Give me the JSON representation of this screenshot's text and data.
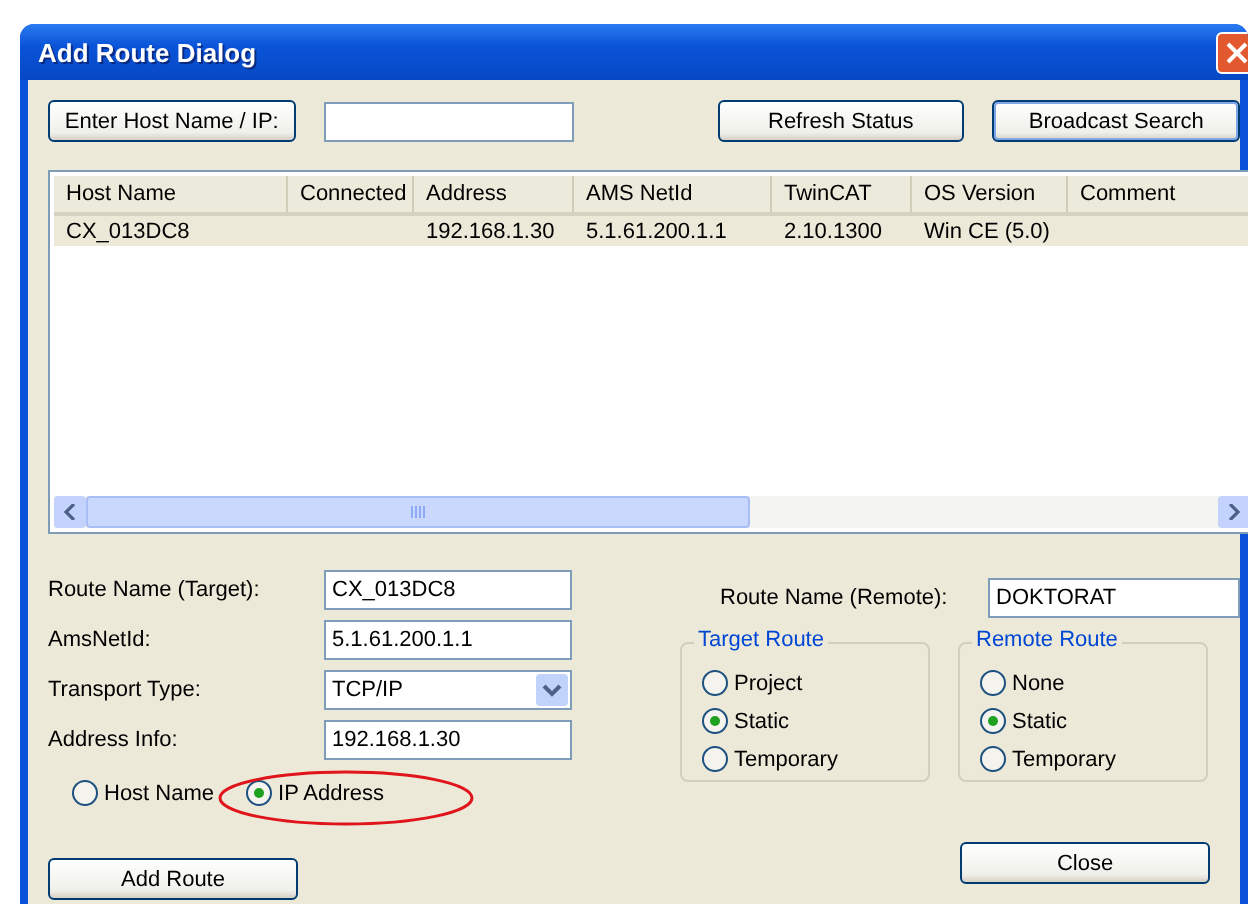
{
  "window": {
    "title": "Add Route Dialog"
  },
  "toolbar": {
    "host_button": "Enter Host Name / IP:",
    "refresh_button": "Refresh Status",
    "broadcast_button": "Broadcast Search"
  },
  "table": {
    "columns": [
      "Host Name",
      "Connected",
      "Address",
      "AMS NetId",
      "TwinCAT",
      "OS Version",
      "Comment"
    ],
    "rows": [
      {
        "selected": true,
        "host_name": "CX_013DC8",
        "address": "192.168.1.30",
        "ams_netid": "5.1.61.200.1.1",
        "twincat": "2.10.1300",
        "os_version": "Win CE (5.0)"
      }
    ]
  },
  "route_name_target": {
    "label": "Route Name (Target):",
    "value": "CX_013DC8"
  },
  "ams_netid": {
    "label": "AmsNetId:",
    "value": "5.1.61.200.1.1"
  },
  "transport_type": {
    "label": "Transport Type:",
    "value": "TCP/IP"
  },
  "address_info": {
    "label": "Address Info:",
    "value": "192.168.1.30"
  },
  "address_mode": [
    {
      "label": "Host Name",
      "selected": false
    },
    {
      "label": "IP Address",
      "selected": true
    }
  ],
  "add_route_button": "Add Route",
  "route_name_remote": {
    "label": "Route Name (Remote):",
    "value": "DOKTORAT"
  },
  "target_route": {
    "title": "Target Route",
    "options": [
      {
        "label": "Project",
        "selected": false
      },
      {
        "label": "Static",
        "selected": true
      },
      {
        "label": "Temporary",
        "selected": false
      }
    ]
  },
  "remote_route": {
    "title": "Remote Route",
    "options": [
      {
        "label": "None",
        "selected": false
      },
      {
        "label": "Static",
        "selected": true
      },
      {
        "label": "Temporary",
        "selected": false
      }
    ]
  },
  "close_button": "Close"
}
